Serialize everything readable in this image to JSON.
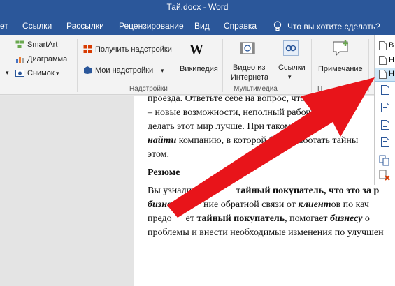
{
  "window": {
    "title": "Тай.docx  -  Word"
  },
  "tabs": [
    {
      "label": "ет"
    },
    {
      "label": "Ссылки"
    },
    {
      "label": "Рассылки"
    },
    {
      "label": "Рецензирование"
    },
    {
      "label": "Вид"
    },
    {
      "label": "Справка"
    }
  ],
  "tell_me": {
    "text": "Что вы хотите сделать?"
  },
  "ribbon": {
    "smartart": "SmartArt",
    "diagram": "Диаграмма",
    "snapshot": "Снимок",
    "get_addins": "Получить надстройки",
    "my_addins": "Мои надстройки",
    "wikipedia": "Википедия",
    "video_line1": "Видео из",
    "video_line2": "Интернета",
    "links": "Ссылки",
    "comment": "Примечание",
    "group_addins": "Надстройки",
    "group_media": "Мультимедиа",
    "group_comments_partial": "П"
  },
  "menu_items": [
    {
      "label": "В"
    },
    {
      "label": "Н"
    },
    {
      "label": "Н"
    }
  ],
  "document": {
    "line1": "проезда. Ответьте себе на вопрос, что вы",
    "line2": "– новые возможности, неполный рабочий",
    "line3": "делать этот мир лучше. При таком",
    "line4a": "найти",
    "line4b": " компанию, в которой бу",
    "line4c": "работать тайны",
    "line5": "этом.",
    "heading": "Резюме",
    "line6a": "Вы узнали ",
    "line6b": "кто",
    "line6c": "тайный покупатель",
    "line6d": ", что это за р",
    "line7a": "бизнеса",
    "line7b": ".  П",
    "line7c": "ние обратной связи от ",
    "line7d": "клиент",
    "line7e": "ов по кач",
    "line8a": "предо",
    "line8b": "ет ",
    "line8c": "тайный покупатель",
    "line8d": ", помогает ",
    "line8e": "бизнесу",
    "line8f": " о",
    "line9": "проблемы и внести необходимые изменения по улучшен"
  },
  "colors": {
    "accent": "#2b579a",
    "arrow": "#e8141a",
    "highlight": "#cde6f7"
  }
}
